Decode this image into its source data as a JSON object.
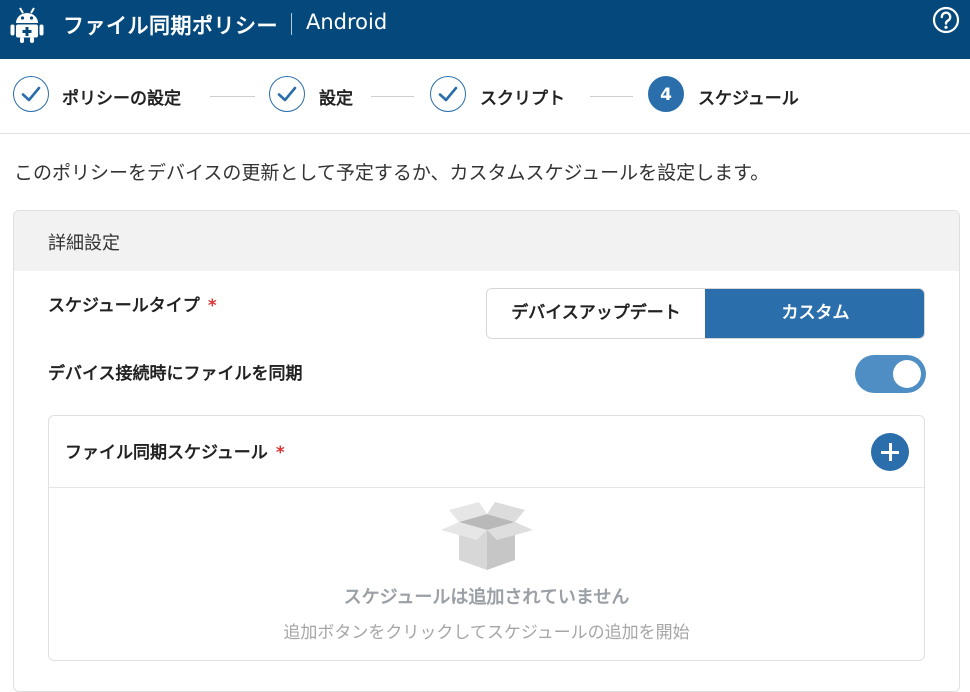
{
  "header": {
    "title": "ファイル同期ポリシー",
    "platform": "Android",
    "bg_color": "#05497c",
    "icons": {
      "app": "android-icon",
      "help": "help-icon"
    }
  },
  "steps": [
    {
      "label": "ポリシーの設定",
      "state": "done"
    },
    {
      "label": "設定",
      "state": "done"
    },
    {
      "label": "スクリプト",
      "state": "done"
    },
    {
      "label": "スケジュール",
      "state": "active",
      "number": "4"
    }
  ],
  "description": "このポリシーをデバイスの更新として予定するか、カスタムスケジュールを設定します。",
  "panel": {
    "title": "詳細設定",
    "schedule_type": {
      "label": "スケジュールタイプ",
      "required_mark": "*",
      "options": [
        "デバイスアップデート",
        "カスタム"
      ],
      "selected": "カスタム"
    },
    "sync_on_connect": {
      "label": "デバイス接続時にファイルを同期",
      "enabled": true
    },
    "file_sync_schedule": {
      "label": "ファイル同期スケジュール",
      "required_mark": "*",
      "empty_title": "スケジュールは追加されていません",
      "empty_hint": "追加ボタンをクリックしてスケジュールの追加を開始"
    }
  },
  "colors": {
    "accent": "#2a6eab",
    "toggle_on": "#4f8ec4",
    "required": "#dd3333"
  }
}
